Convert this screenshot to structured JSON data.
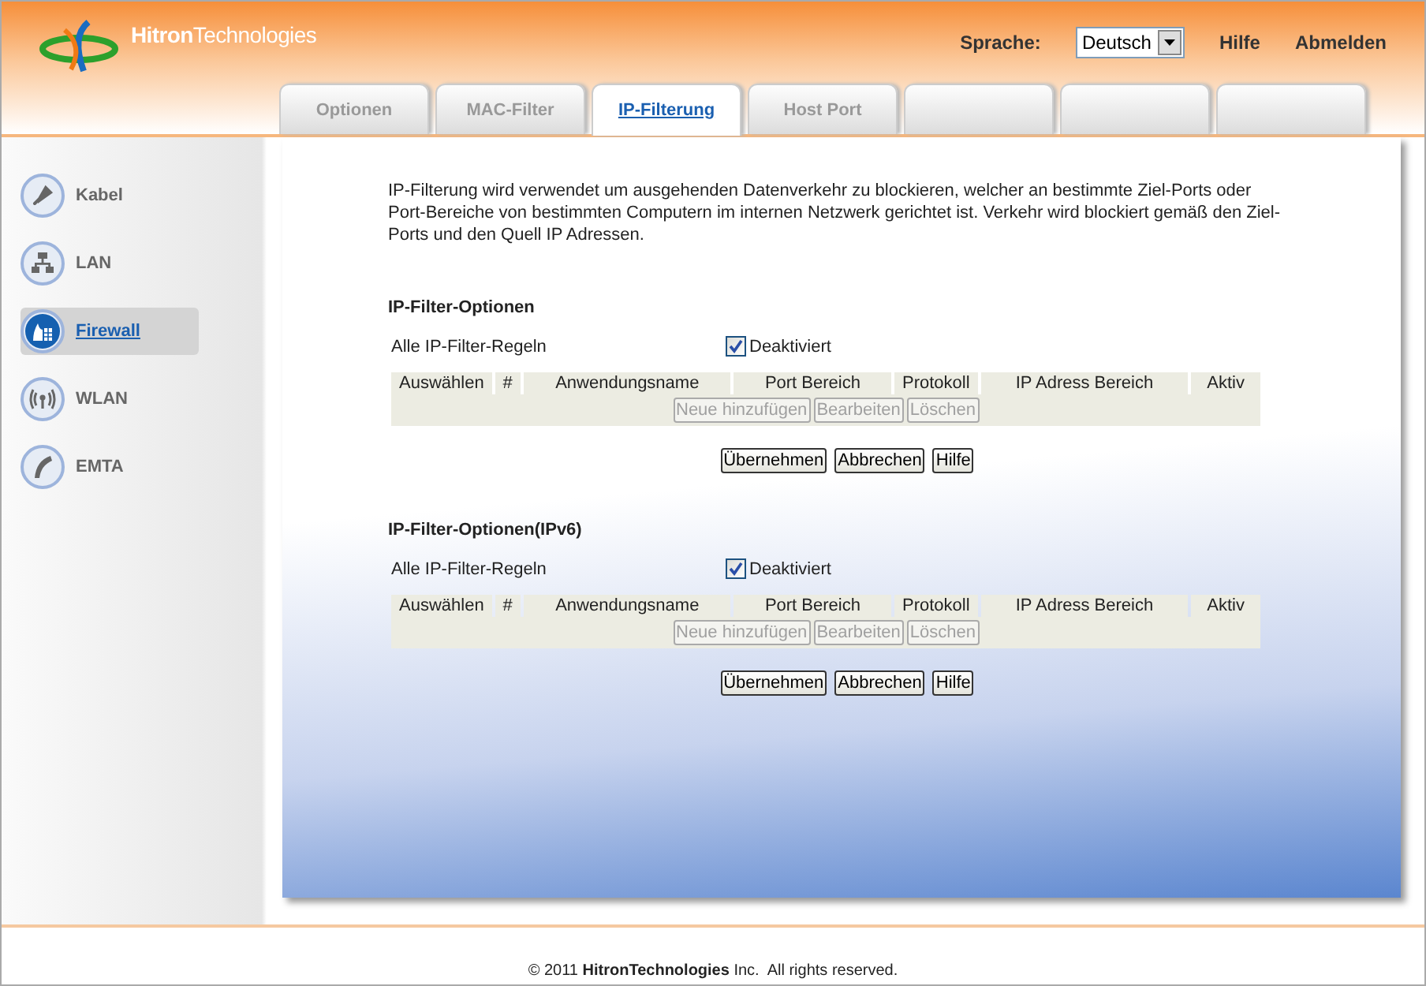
{
  "header": {
    "logo": "**Hitron**Technologies",
    "language_label": "Sprache:",
    "language_value": "Deutsch",
    "links": [
      "Hilfe",
      "Abmelden"
    ]
  },
  "tabs": [
    {
      "kind": "text",
      "label": "Optionen",
      "selected": false
    },
    {
      "kind": "text",
      "label": "MAC-Filter",
      "selected": false
    },
    {
      "kind": "text",
      "label": "IP-Filterung",
      "selected": true
    },
    {
      "kind": "text",
      "label": "Host Port",
      "selected": false
    },
    {
      "kind": "blank",
      "selected": false
    },
    {
      "kind": "blank",
      "selected": false
    },
    {
      "kind": "blank",
      "selected": false
    }
  ],
  "sidebar": {
    "items": [
      {
        "kind": "cable",
        "label": "Kabel",
        "selected": false
      },
      {
        "kind": "lan",
        "label": "LAN",
        "selected": false
      },
      {
        "kind": "firewall",
        "label": "Firewall",
        "selected": true
      },
      {
        "kind": "wlan",
        "label": "WLAN",
        "selected": false
      },
      {
        "kind": "phone",
        "label": "EMTA",
        "selected": false
      }
    ]
  },
  "intro": "IP-Filterung wird verwendet um ausgehenden Datenverkehr zu blockieren, welcher an bestimmte Ziel-Ports oder Port-Bereiche von bestimmten Computern im internen Netzwerk gerichtet ist. Verkehr wird blockiert gemäß den Ziel-Ports und den Quell IP Adressen.",
  "sections": [
    {
      "title": "IP-Filter-Optionen",
      "rule_label": "Alle IP-Filter-Regeln",
      "checkbox": {
        "label": "Deaktiviert",
        "checked": true
      },
      "columns": [
        "Auswählen",
        "#",
        "Anwendungsname",
        "Port Bereich",
        "Protokoll",
        "IP Adress Bereich",
        "Aktiv"
      ],
      "row_buttons": [
        {
          "label": "Neue hinzufügen",
          "disabled": true
        },
        {
          "label": "Bearbeiten",
          "disabled": true
        },
        {
          "label": "Löschen",
          "disabled": true
        }
      ],
      "buttons": [
        "Übernehmen",
        "Abbrechen",
        "Hilfe"
      ]
    },
    {
      "title": "IP-Filter-Optionen(IPv6)",
      "rule_label": "Alle IP-Filter-Regeln",
      "checkbox": {
        "label": "Deaktiviert",
        "checked": true
      },
      "columns": [
        "Auswählen",
        "#",
        "Anwendungsname",
        "Port Bereich",
        "Protokoll",
        "IP Adress Bereich",
        "Aktiv"
      ],
      "row_buttons": [
        {
          "label": "Neue hinzufügen",
          "disabled": true
        },
        {
          "label": "Bearbeiten",
          "disabled": true
        },
        {
          "label": "Löschen",
          "disabled": true
        }
      ],
      "buttons": [
        "Übernehmen",
        "Abbrechen",
        "Hilfe"
      ]
    }
  ],
  "footer": "© 2011 **HitronTechnologies** Inc.  All rights reserved."
}
